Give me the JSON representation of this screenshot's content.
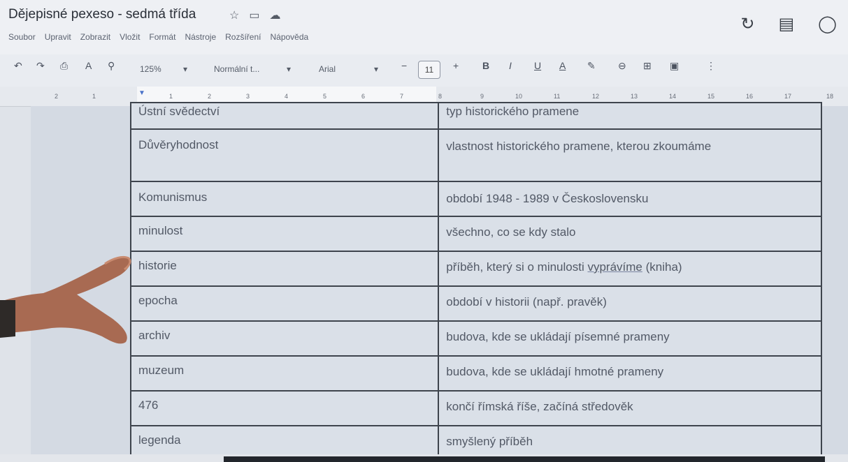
{
  "doc": {
    "title": "Dějepisné pexeso - sedmá třída",
    "title_icons": [
      "star-icon",
      "folder-icon",
      "cloud-icon"
    ],
    "menu": [
      "Soubor",
      "Upravit",
      "Zobrazit",
      "Vložit",
      "Formát",
      "Nástroje",
      "Rozšíření",
      "Nápověda"
    ],
    "right_icons": {
      "history": "↻",
      "comments": "▤",
      "meet": "◯"
    }
  },
  "toolbar": {
    "undo": "↶",
    "redo": "↷",
    "print": "⎙",
    "spell": "A",
    "paint": "⚲",
    "zoom": "125%",
    "style": "Normální t...",
    "font": "Arial",
    "minus": "−",
    "font_size": "11",
    "plus": "+",
    "bold": "B",
    "italic": "I",
    "underline": "U",
    "text_color": "A",
    "highlight": "✎",
    "link": "⊖",
    "comment": "⊞",
    "image": "▣",
    "more": "⋮"
  },
  "ruler": {
    "left_numbers": [
      "2",
      "1"
    ],
    "numbers": [
      "1",
      "2",
      "3",
      "4",
      "5",
      "6",
      "7",
      "8",
      "9",
      "10",
      "11",
      "12",
      "13",
      "14",
      "15",
      "16",
      "17",
      "18"
    ]
  },
  "table": {
    "rows": [
      {
        "term": "Ústní svědectví",
        "definition": "typ historického pramene"
      },
      {
        "term": "Důvěryhodnost",
        "definition": "vlastnost historického pramene, kterou zkoumáme"
      },
      {
        "term": "Komunismus",
        "definition": "období 1948 - 1989 v Československu"
      },
      {
        "term": "minulost",
        "definition": "všechno, co se kdy stalo"
      },
      {
        "term": "historie",
        "definition_pre": "příběh, který si o minulosti ",
        "definition_ul": "vyprávíme",
        "definition_post": " (kniha)"
      },
      {
        "term": "epocha",
        "definition": "období v historii (např. pravěk)"
      },
      {
        "term": "archiv",
        "definition": "budova, kde se ukládají písemné prameny"
      },
      {
        "term": "muzeum",
        "definition": "budova, kde se ukládají hmotné prameny"
      },
      {
        "term": "476",
        "definition": "končí římská říše, začíná středověk"
      },
      {
        "term": "legenda",
        "definition": "smyšlený příběh"
      }
    ]
  }
}
